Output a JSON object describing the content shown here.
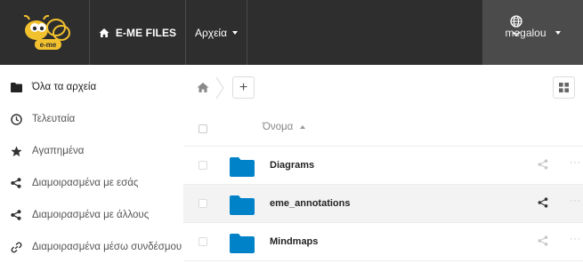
{
  "header": {
    "logo_text": "e-me",
    "brand_label": "E-ME FILES",
    "apps_menu_label": "Αρχεία",
    "user_label": "megalou",
    "colors": {
      "bar": "#2e2e2e",
      "user_bg": "#4b4b4b",
      "logo_yellow": "#f2c12e"
    }
  },
  "sidebar": {
    "items": [
      {
        "label": "Όλα τα αρχεία",
        "icon": "folder-icon",
        "active": true
      },
      {
        "label": "Τελευταία",
        "icon": "clock-icon"
      },
      {
        "label": "Αγαπημένα",
        "icon": "star-icon"
      },
      {
        "label": "Διαμοιρασμένα με εσάς",
        "icon": "share-icon"
      },
      {
        "label": "Διαμοιρασμένα με άλλους",
        "icon": "share-icon"
      },
      {
        "label": "Διαμοιρασμένα μέσω συνδέσμου",
        "icon": "link-icon"
      }
    ]
  },
  "breadcrumb": {
    "add_label": "+"
  },
  "files": {
    "column_name": "Όνομα",
    "folder_color": "#0082c9",
    "rows": [
      {
        "name": "Diagrams"
      },
      {
        "name": "eme_annotations"
      },
      {
        "name": "Mindmaps"
      }
    ],
    "more_label": "···"
  }
}
